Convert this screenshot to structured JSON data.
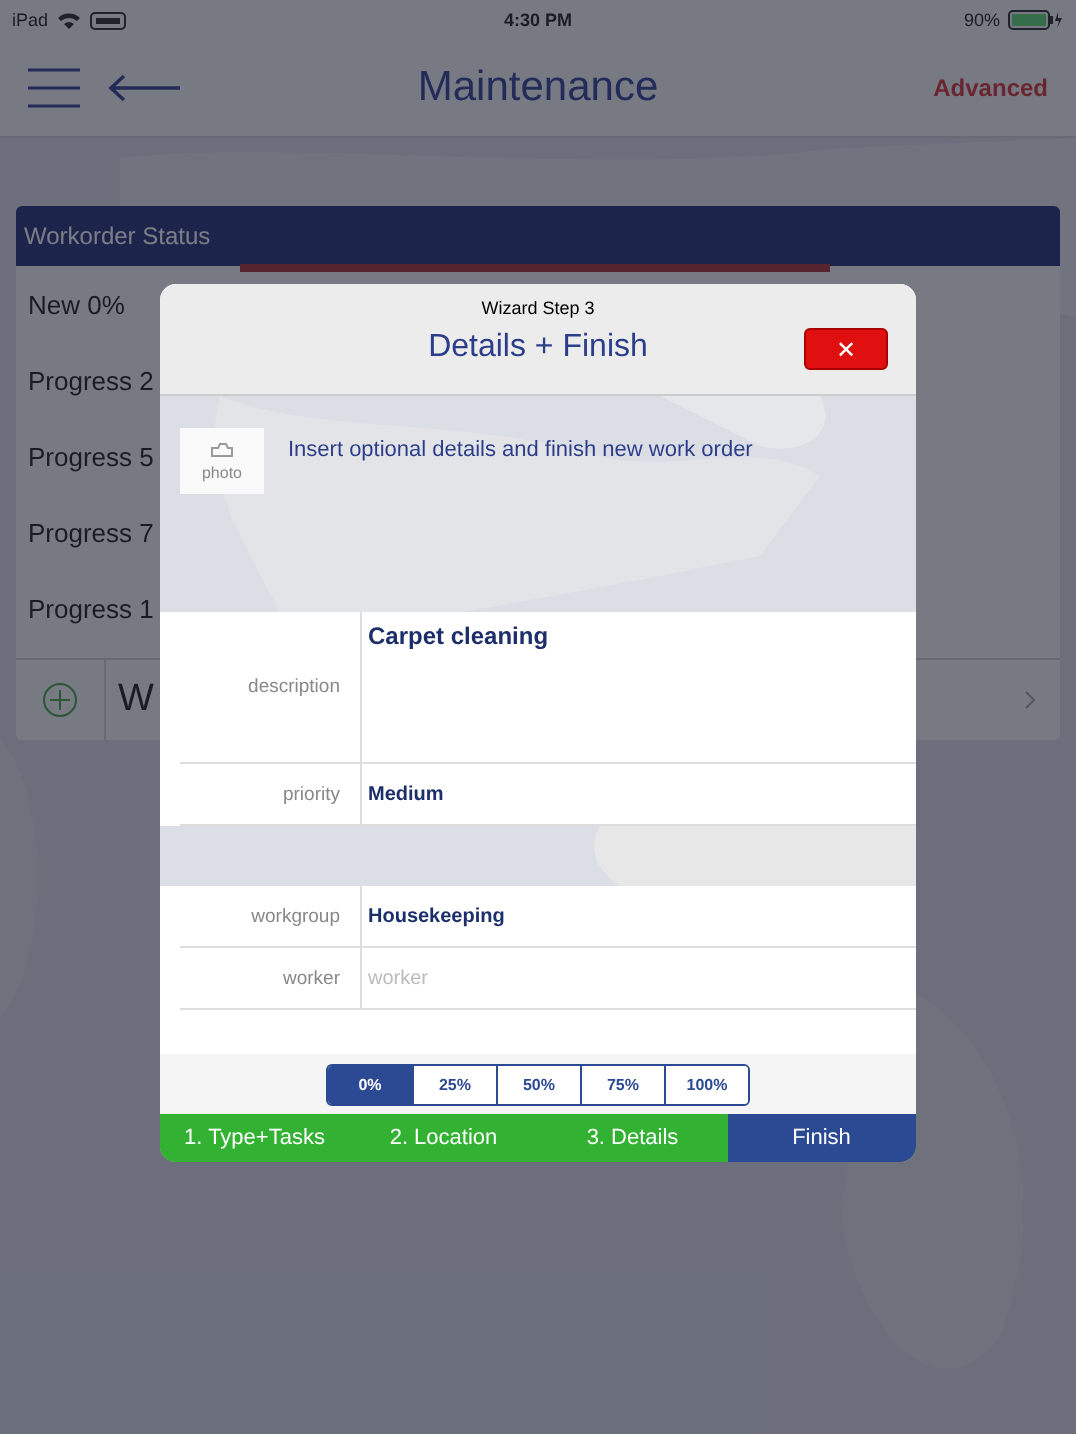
{
  "status_bar": {
    "device": "iPad",
    "time": "4:30 PM",
    "battery": "90%"
  },
  "nav": {
    "title": "Maintenance",
    "action": "Advanced"
  },
  "panel": {
    "title": "Workorder Status",
    "rows": [
      "New 0%",
      "Progress 2",
      "Progress 5",
      "Progress 7",
      "Progress 1"
    ],
    "add_row": "W"
  },
  "dialog": {
    "step": "Wizard Step 3",
    "title": "Details + Finish",
    "close": "✕",
    "photo": "photo",
    "intro": "Insert optional details and finish new work order",
    "fields": [
      {
        "kind": "area",
        "label": "description",
        "value": "Carpet cleaning"
      },
      {
        "kind": "line",
        "label": "priority",
        "value": "Medium"
      },
      {
        "kind": "gap"
      },
      {
        "kind": "line",
        "label": "workgroup",
        "value": "Housekeeping"
      },
      {
        "kind": "line",
        "label": "worker",
        "placeholder": "worker"
      }
    ],
    "progress": [
      {
        "label": "0%",
        "selected": true
      },
      {
        "label": "25%",
        "selected": false
      },
      {
        "label": "50%",
        "selected": false
      },
      {
        "label": "75%",
        "selected": false
      },
      {
        "label": "100%",
        "selected": false
      }
    ],
    "steps": [
      {
        "label": "1. Type+Tasks",
        "selected": false
      },
      {
        "label": "2. Location",
        "selected": false
      },
      {
        "label": "3. Details",
        "selected": false
      },
      {
        "label": "Finish",
        "selected": true
      }
    ]
  }
}
